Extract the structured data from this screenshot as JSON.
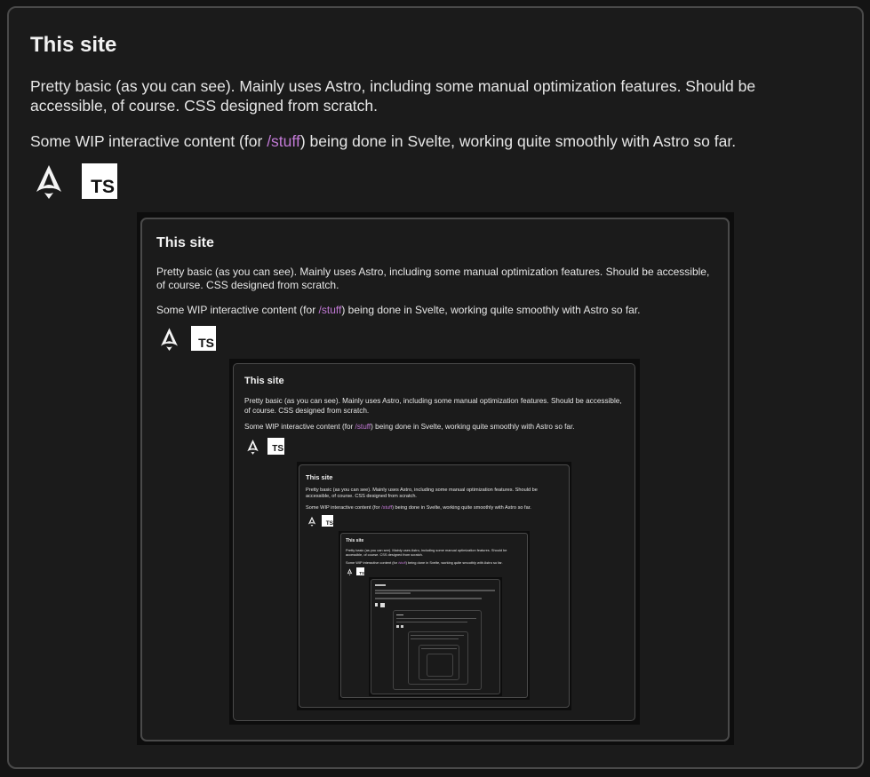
{
  "card": {
    "title": "This site",
    "para1": "Pretty basic (as you can see). Mainly uses Astro, including some manual optimization features. Should be accessible, of course. CSS designed from scratch.",
    "para2_before": "Some WIP interactive content (for ",
    "para2_link": "/stuff",
    "para2_after": ") being done in Svelte, working quite smoothly with Astro so far.",
    "ts_label": "TS"
  },
  "icons": [
    "astro-icon",
    "typescript-icon"
  ],
  "colors": {
    "background": "#1b1b1b",
    "border": "#4a4a4a",
    "text": "#e6e6e6",
    "link": "#c27ad6"
  }
}
